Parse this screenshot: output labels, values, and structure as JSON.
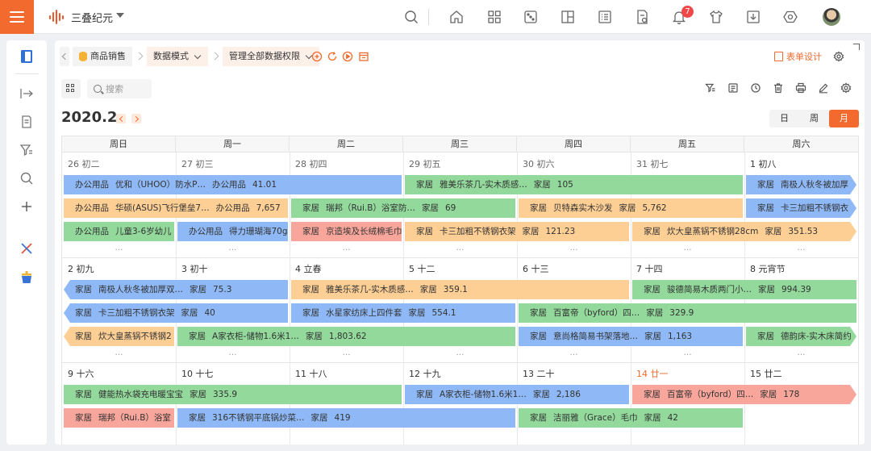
{
  "app": {
    "name": "三叠纪元",
    "notification_count": "7",
    "accent": "#f26a2e"
  },
  "breadcrumb": {
    "module": "商品销售",
    "mode": "数据模式",
    "permission": "管理全部数据权限"
  },
  "toolbar": {
    "form_design": "表单设计",
    "search_placeholder": "搜索"
  },
  "calendar": {
    "period": "2020.2",
    "views": [
      "日",
      "周",
      "月"
    ],
    "active_view": "月",
    "weekdays": [
      "周日",
      "周一",
      "周二",
      "周三",
      "周四",
      "周五",
      "周六"
    ],
    "weeks": [
      {
        "days": [
          "26 初二",
          "27 初三",
          "28 初四",
          "29 初五",
          "30 初六",
          "31 初七",
          "1 初八"
        ],
        "events": [
          {
            "category": "办公用品",
            "name": "优和（UHOO）防水P…",
            "cat2": "办公用品",
            "amount": "41.01",
            "color": "blue"
          },
          {
            "category": "家居",
            "name": "雅美乐茶几-实木质感…",
            "cat2": "家居",
            "amount": "105",
            "color": "green"
          },
          {
            "category": "家居",
            "name": "南极人秋冬被加厚",
            "cat2": "",
            "amount": "",
            "color": "blue"
          },
          {
            "category": "办公用品",
            "name": "华硕(ASUS)飞行堡垒7…",
            "cat2": "办公用品",
            "amount": "7,657",
            "color": "orange"
          },
          {
            "category": "家居",
            "name": "瑞邦（Rui.B）浴室防…",
            "cat2": "家居",
            "amount": "69",
            "color": "green"
          },
          {
            "category": "家居",
            "name": "贝特森实木沙发",
            "cat2": "家居",
            "amount": "5,762",
            "color": "orange"
          },
          {
            "category": "家居",
            "name": "卡三加粗不锈钢衣",
            "cat2": "",
            "amount": "",
            "color": "blue"
          },
          {
            "category": "办公用品",
            "name": "儿童3-6岁幼儿",
            "cat2": "",
            "amount": "",
            "color": "green"
          },
          {
            "category": "办公用品",
            "name": "得力珊瑚海70g",
            "cat2": "",
            "amount": "",
            "color": "blue"
          },
          {
            "category": "家居",
            "name": "京造埃及长绒棉毛巾",
            "cat2": "",
            "amount": "",
            "color": "pink"
          },
          {
            "category": "家居",
            "name": "卡三加粗不锈钢衣架",
            "cat2": "家居",
            "amount": "121.23",
            "color": "orange"
          },
          {
            "category": "家居",
            "name": "炊大皇蒸锅不锈钢28cm",
            "cat2": "家居",
            "amount": "351.53",
            "color": "orange"
          }
        ]
      },
      {
        "days": [
          "2 初九",
          "3 初十",
          "4 立春",
          "5 十二",
          "6 十三",
          "7 十四",
          "8 元宵节"
        ],
        "events": [
          {
            "category": "家居",
            "name": "南极人秋冬被加厚双…",
            "cat2": "家居",
            "amount": "75.3",
            "color": "blue"
          },
          {
            "category": "家居",
            "name": "雅美乐茶几-实木质感…",
            "cat2": "家居",
            "amount": "359.1",
            "color": "orange"
          },
          {
            "category": "家居",
            "name": "骏德简易木质两门小…",
            "cat2": "家居",
            "amount": "994.39",
            "color": "green"
          },
          {
            "category": "家居",
            "name": "卡三加粗不锈钢衣架",
            "cat2": "家居",
            "amount": "40",
            "color": "blue"
          },
          {
            "category": "家居",
            "name": "水星家纺床上四件套",
            "cat2": "家居",
            "amount": "554.1",
            "color": "blue"
          },
          {
            "category": "家居",
            "name": "百富帝（byford）四…",
            "cat2": "家居",
            "amount": "329.9",
            "color": "green"
          },
          {
            "category": "家居",
            "name": "炊大皇蒸锅不锈钢2",
            "cat2": "",
            "amount": "",
            "color": "orange"
          },
          {
            "category": "家居",
            "name": "A家衣柜-储物1.6米1…",
            "cat2": "家居",
            "amount": "1,803.62",
            "color": "green"
          },
          {
            "category": "家居",
            "name": "意尚格简易书架落地…",
            "cat2": "家居",
            "amount": "1,163",
            "color": "blue"
          },
          {
            "category": "家居",
            "name": "德韵床-实木床简约",
            "cat2": "",
            "amount": "",
            "color": "green"
          }
        ]
      },
      {
        "days": [
          "9 十六",
          "10 十七",
          "11 十八",
          "12 十九",
          "13 二十",
          "14 廿一",
          "15 廿二"
        ],
        "events": [
          {
            "category": "家居",
            "name": "健能热水袋充电暖宝宝",
            "cat2": "家居",
            "amount": "335.9",
            "color": "green"
          },
          {
            "category": "家居",
            "name": "A家衣柜-储物1.6米1…",
            "cat2": "家居",
            "amount": "2,186",
            "color": "blue"
          },
          {
            "category": "家居",
            "name": "百富帝（byford）四…",
            "cat2": "家居",
            "amount": "178",
            "color": "pink"
          },
          {
            "category": "家居",
            "name": "瑞邦（Rui.B）浴室",
            "cat2": "",
            "amount": "",
            "color": "pink"
          },
          {
            "category": "家居",
            "name": "316不锈钢平底锅炒菜…",
            "cat2": "家居",
            "amount": "419",
            "color": "blue"
          },
          {
            "category": "家居",
            "name": "洁丽雅（Grace）毛巾",
            "cat2": "家居",
            "amount": "42",
            "color": "green"
          }
        ]
      }
    ]
  }
}
